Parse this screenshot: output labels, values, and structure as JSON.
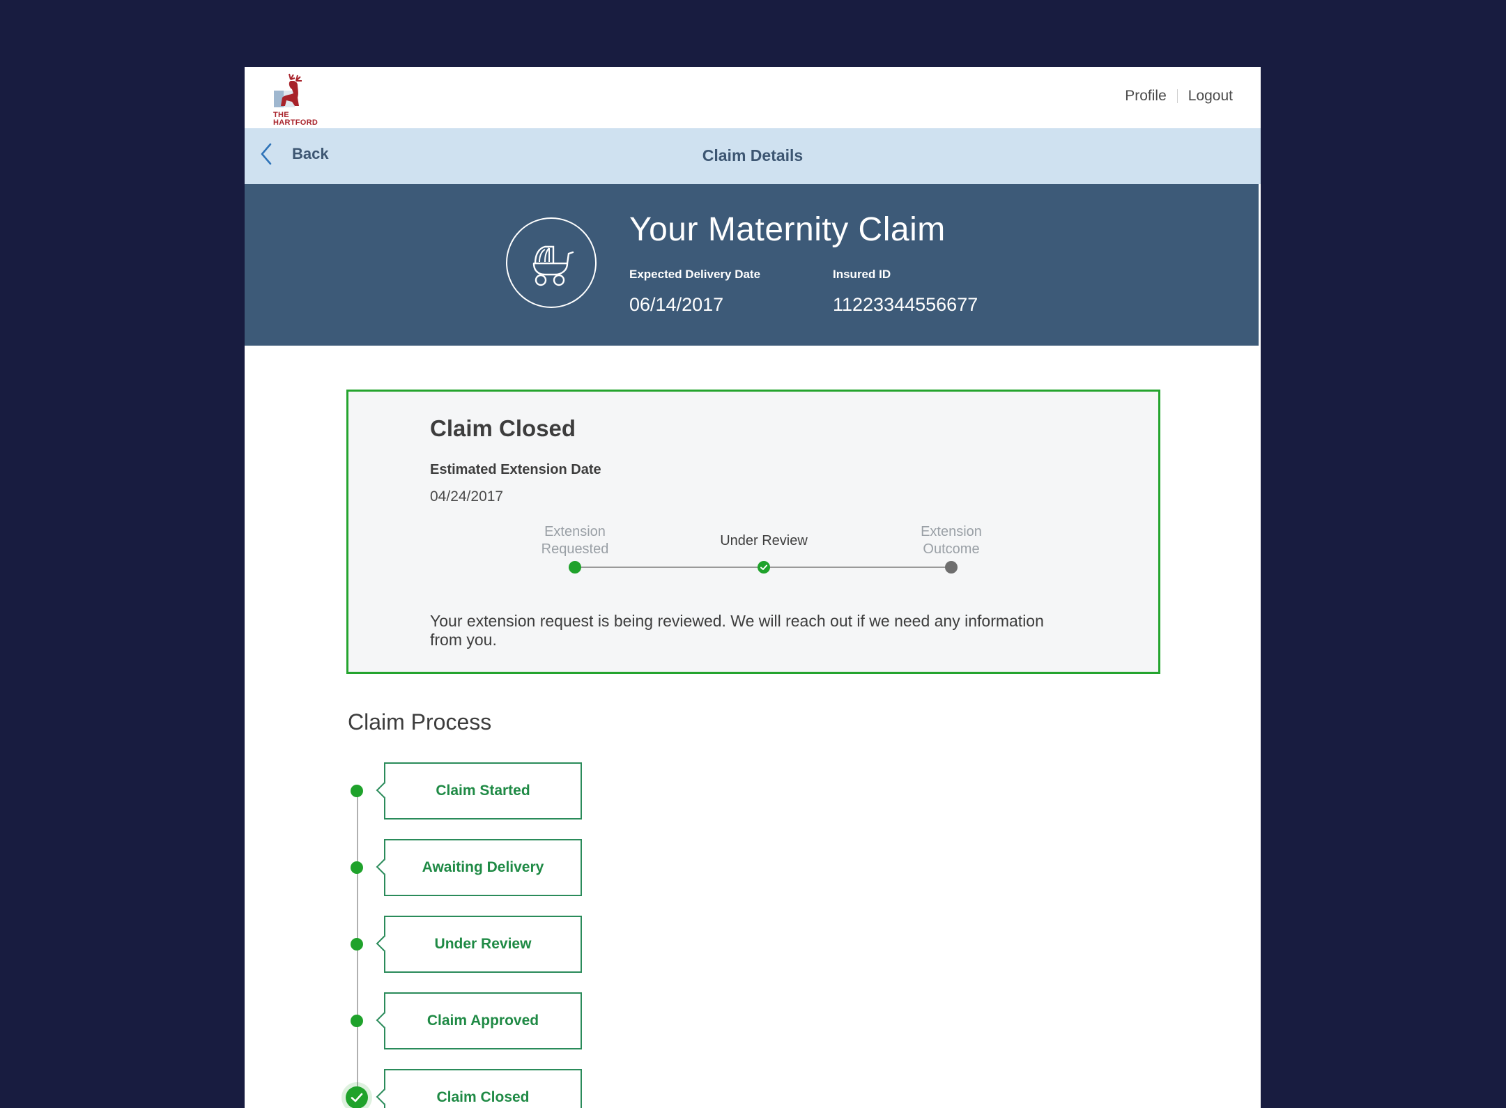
{
  "header": {
    "logo_text_line1": "THE",
    "logo_text_line2": "HARTFORD",
    "profile_label": "Profile",
    "logout_label": "Logout"
  },
  "subnav": {
    "back_label": "Back",
    "title": "Claim Details"
  },
  "hero": {
    "icon": "baby-carriage-icon",
    "title": "Your Maternity Claim",
    "fields": [
      {
        "label": "Expected Delivery Date",
        "value": "06/14/2017"
      },
      {
        "label": "Insured ID",
        "value": "11223344556677"
      }
    ]
  },
  "status": {
    "title": "Claim Closed",
    "sub_label": "Estimated Extension Date",
    "sub_value": "04/24/2017",
    "steps": [
      {
        "line1": "Extension",
        "line2": "Requested",
        "state": "done"
      },
      {
        "line1": "Under Review",
        "line2": "",
        "state": "current"
      },
      {
        "line1": "Extension",
        "line2": "Outcome",
        "state": "future"
      }
    ],
    "message": "Your extension request is being reviewed. We will reach out if we need any information from you."
  },
  "process": {
    "title": "Claim Process",
    "steps": [
      {
        "label": "Claim Started",
        "state": "done"
      },
      {
        "label": "Awaiting Delivery",
        "state": "done"
      },
      {
        "label": "Under Review",
        "state": "done"
      },
      {
        "label": "Claim Approved",
        "state": "done"
      },
      {
        "label": "Claim Closed",
        "state": "current"
      }
    ]
  },
  "colors": {
    "background": "#181c40",
    "accent_green": "#1fa22b",
    "hero_blue": "#3d5a78",
    "subnav_blue": "#cfe1f0"
  }
}
